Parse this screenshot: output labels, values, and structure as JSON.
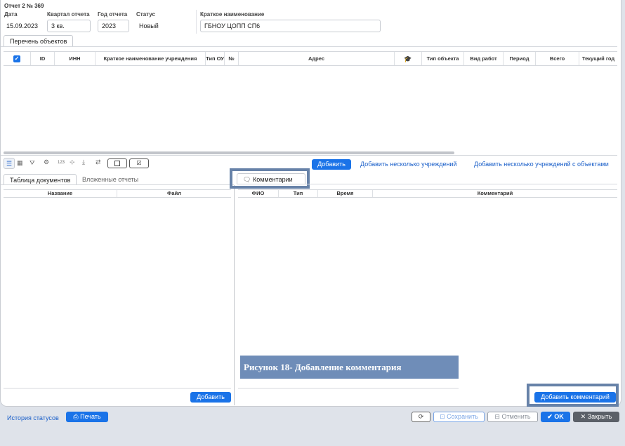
{
  "header": {
    "title": "Отчет 2 № 369",
    "date_label": "Дата",
    "date_value": "15.09.2023",
    "quarter_label": "Квартал отчета",
    "quarter_value": "3 кв.",
    "year_label": "Год отчета",
    "year_value": "2023",
    "status_label": "Статус",
    "status_value": "Новый",
    "shortname_label": "Краткое наименование",
    "shortname_value": "ГБНОУ ЦОПП СП6"
  },
  "objects_tab": {
    "label": "Перечень объектов"
  },
  "objects_table": {
    "columns": [
      "ID",
      "ИНН",
      "Краткое наименование учреждения",
      "Тип ОУ",
      "№",
      "Адрес",
      "Тип объекта",
      "Вид работ",
      "Период",
      "Всего",
      "Текущий год"
    ]
  },
  "toolbar": {
    "counter_label": "123",
    "add_button": "Добавить",
    "add_many_link": "Добавить несколько учреждений",
    "add_many_objects_link": "Добавить несколько учреждений с объектами"
  },
  "docs": {
    "tab_docs": "Таблица документов",
    "tab_nested": "Вложенные отчеты",
    "columns": [
      "Название",
      "Файл"
    ],
    "add_button": "Добавить"
  },
  "comments": {
    "tab_label": "Комментарии",
    "columns": [
      "ФИО",
      "Тип",
      "Время",
      "Комментарий"
    ],
    "add_button": "Добавить комментарий",
    "caption": "Рисунок 18- Добавление комментария"
  },
  "footer": {
    "history_link": "История статусов",
    "print_button": "Печать",
    "save_button": "Сохранить",
    "cancel_button": "Отменить",
    "ok_button": "OK",
    "close_button": "Закрыть"
  },
  "colors": {
    "accent": "#1a73e8",
    "highlight": "#6782a8",
    "caption_bg": "#6f8db8"
  }
}
